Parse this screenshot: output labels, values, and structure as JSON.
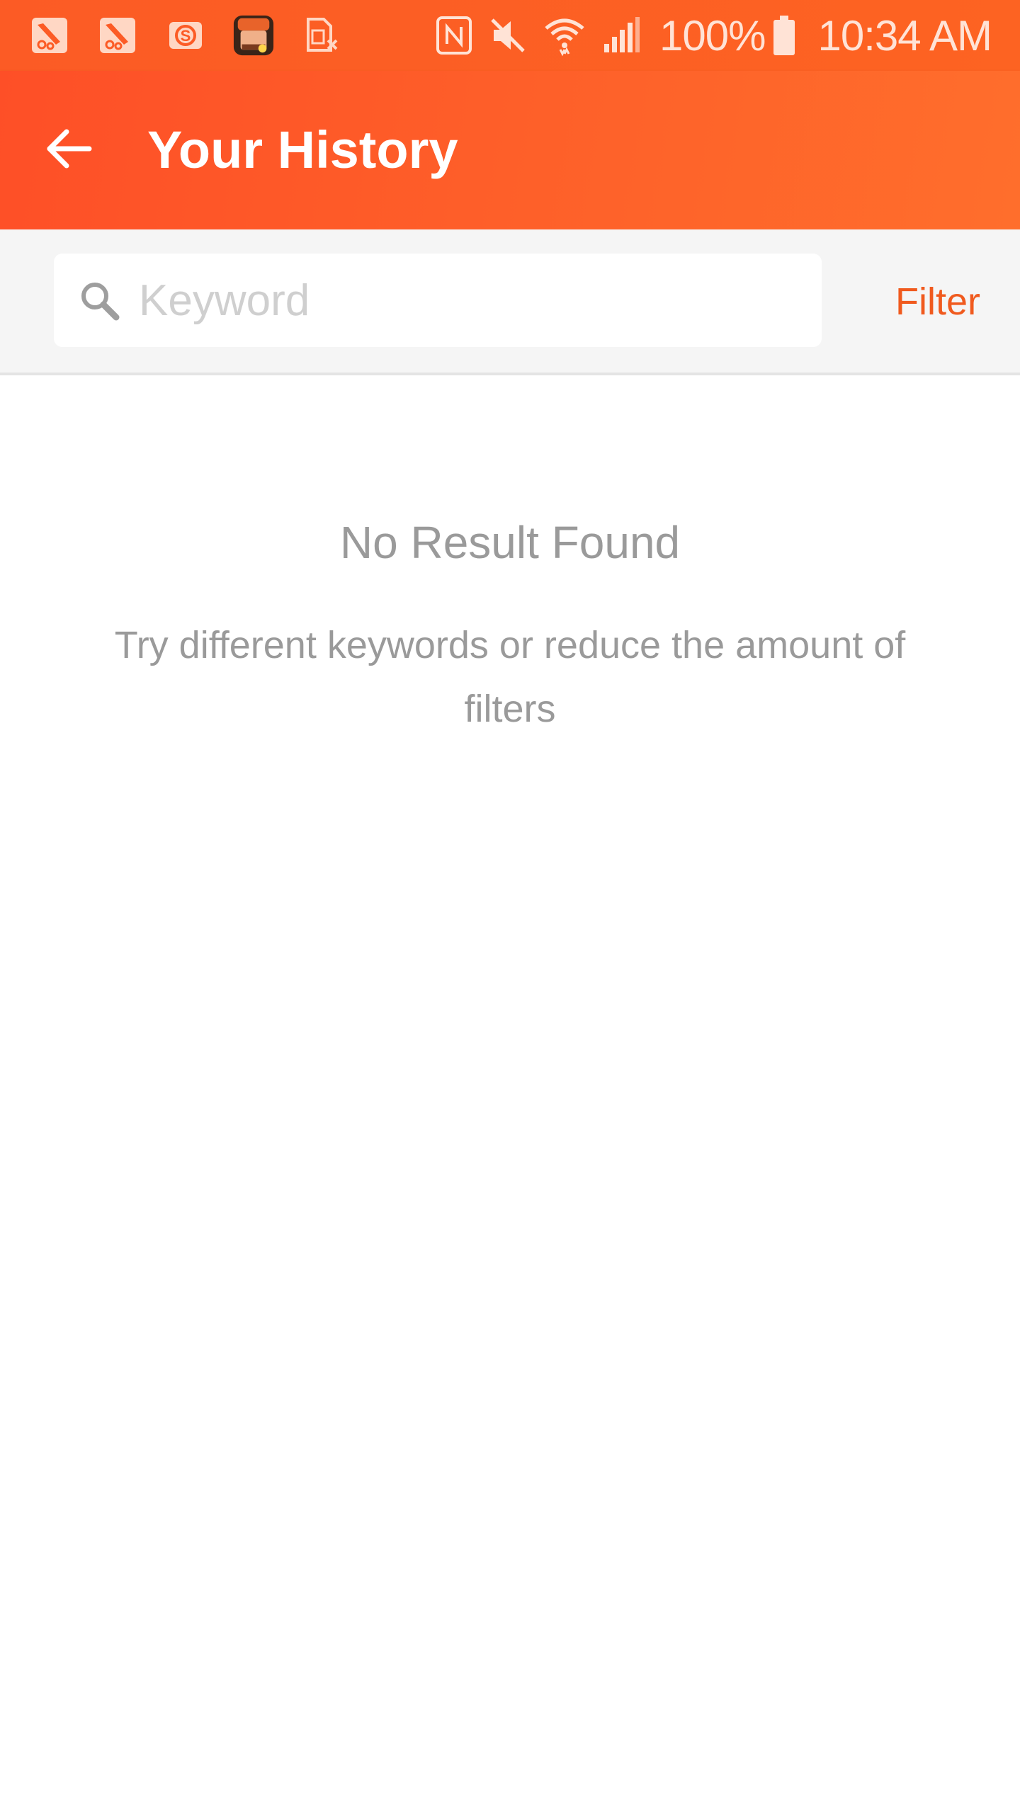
{
  "status_bar": {
    "battery_percent": "100%",
    "time": "10:34 AM",
    "notification_icons": [
      "bird-app-icon",
      "bird-app-icon",
      "dollar-app-icon",
      "game-app-icon",
      "sim-card-off-icon"
    ],
    "system_icons": [
      "nfc-icon",
      "mute-icon",
      "wifi-icon",
      "signal-icon",
      "battery-icon"
    ]
  },
  "app_bar": {
    "title": "Your History",
    "back_icon": "arrow-left-icon"
  },
  "search": {
    "placeholder": "Keyword",
    "value": "",
    "icon": "search-icon",
    "filter_label": "Filter"
  },
  "empty_state": {
    "title": "No Result Found",
    "description": "Try different keywords or reduce the amount of filters"
  },
  "colors": {
    "accent": "#fe5a28",
    "filter_text": "#f05a1e",
    "muted_text": "#9a9a9a",
    "search_bg": "#f5f5f5"
  }
}
